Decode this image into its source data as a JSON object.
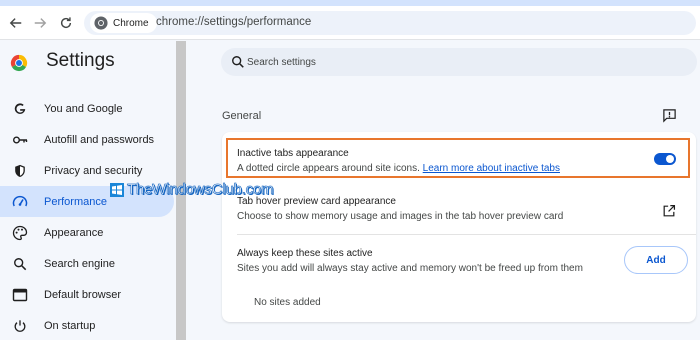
{
  "browser": {
    "chip_label": "Chrome",
    "url": "chrome://settings/performance"
  },
  "sidebar": {
    "title": "Settings",
    "items": [
      {
        "label": "You and Google",
        "icon": "google-g-icon"
      },
      {
        "label": "Autofill and passwords",
        "icon": "key-icon"
      },
      {
        "label": "Privacy and security",
        "icon": "shield-icon"
      },
      {
        "label": "Performance",
        "icon": "gauge-icon",
        "active": true
      },
      {
        "label": "Appearance",
        "icon": "palette-icon"
      },
      {
        "label": "Search engine",
        "icon": "search-icon"
      },
      {
        "label": "Default browser",
        "icon": "browser-window-icon"
      },
      {
        "label": "On startup",
        "icon": "power-icon"
      }
    ]
  },
  "search": {
    "placeholder": "Search settings"
  },
  "main": {
    "section_title": "General",
    "rows": [
      {
        "title": "Inactive tabs appearance",
        "desc": "A dotted circle appears around site icons.",
        "link": "Learn more about inactive tabs",
        "toggle_on": true
      },
      {
        "title": "Tab hover preview card appearance",
        "desc": "Choose to show memory usage and images in the tab hover preview card"
      },
      {
        "title": "Always keep these sites active",
        "desc": "Sites you add will always stay active and memory won't be freed up from them",
        "button": "Add",
        "empty_text": "No sites added"
      }
    ]
  },
  "watermark": {
    "text": "TheWindowsClub.com"
  },
  "colors": {
    "accent": "#0b57d0",
    "active_bg": "#d3e3fd",
    "highlight_border": "#e8762d"
  }
}
